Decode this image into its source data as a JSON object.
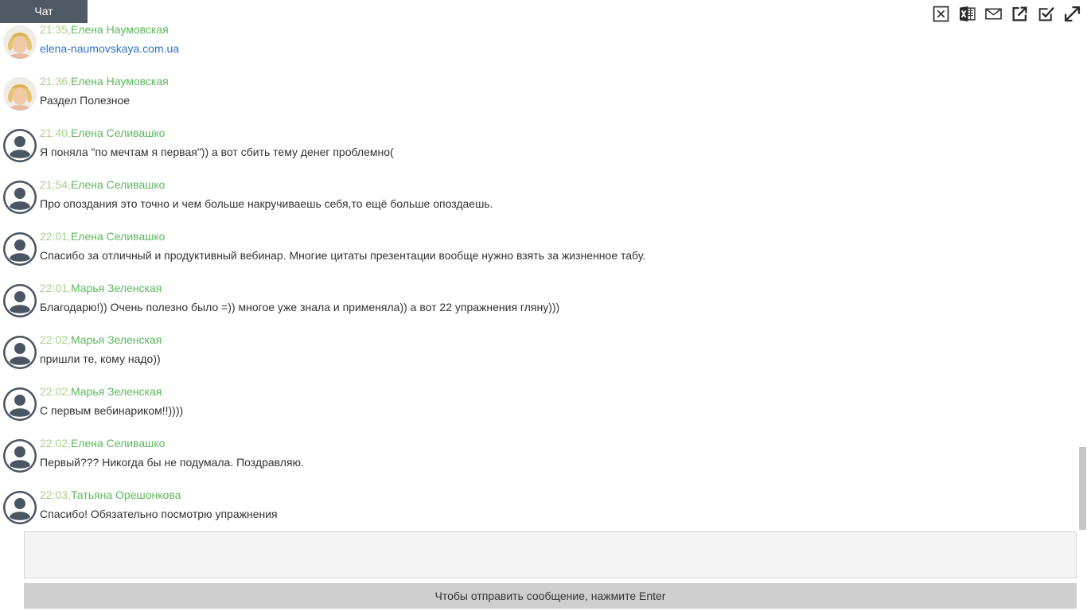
{
  "tab": {
    "label": "Чат"
  },
  "toolbar": {
    "icons": [
      "close-box-icon",
      "excel-icon",
      "mail-icon",
      "external-link-icon",
      "checkbox-icon",
      "expand-icon"
    ]
  },
  "colors": {
    "tab_bg": "#4f5a66",
    "time": "#a9d18e",
    "author": "#5cb85c",
    "link": "#2f72c4",
    "text": "#333333",
    "send_bar": "#cfcfcf"
  },
  "messages": [
    {
      "time": "21:35,",
      "author": "Елена Наумовская",
      "text": "elena-naumovskaya.com.ua",
      "avatar": "photo",
      "link": true
    },
    {
      "time": "21:36,",
      "author": "Елена Наумовская",
      "text": "Раздел Полезное",
      "avatar": "photo",
      "link": false
    },
    {
      "time": "21:40,",
      "author": "Елена Селивашко",
      "text": "Я поняла \"по мечтам я первая\")) а вот сбить тему денег проблемно(",
      "avatar": "default",
      "link": false
    },
    {
      "time": "21:54,",
      "author": "Елена Селивашко",
      "text": "Про опоздания это точно и чем больше накручиваешь себя,то ещё больше опоздаешь.",
      "avatar": "default",
      "link": false
    },
    {
      "time": "22:01,",
      "author": "Елена Селивашко",
      "text": "Спасибо за отличный и продуктивный вебинар. Многие цитаты презентации вообще нужно взять за жизненное табу.",
      "avatar": "default",
      "link": false
    },
    {
      "time": "22:01,",
      "author": "Марья Зеленская",
      "text": "Благодарю!)) Очень полезно было =)) многое уже знала и применяла)) а вот 22 упражнения гляну)))",
      "avatar": "default",
      "link": false
    },
    {
      "time": "22:02,",
      "author": "Марья Зеленская",
      "text": "пришли те, кому надо))",
      "avatar": "default",
      "link": false
    },
    {
      "time": "22:02,",
      "author": "Марья Зеленская",
      "text": "С первым вебинариком!!))))",
      "avatar": "default",
      "link": false
    },
    {
      "time": "22:02,",
      "author": "Елена Селивашко",
      "text": "Первый??? Никогда бы не подумала. Поздравляю.",
      "avatar": "default",
      "link": false
    },
    {
      "time": "22:03,",
      "author": "Татьяна Орешонкова",
      "text": "Спасибо! Обязательно посмотрю упражнения",
      "avatar": "default",
      "link": false
    }
  ],
  "input": {
    "placeholder": "",
    "value": ""
  },
  "send_hint": "Чтобы отправить сообщение, нажмите Enter"
}
